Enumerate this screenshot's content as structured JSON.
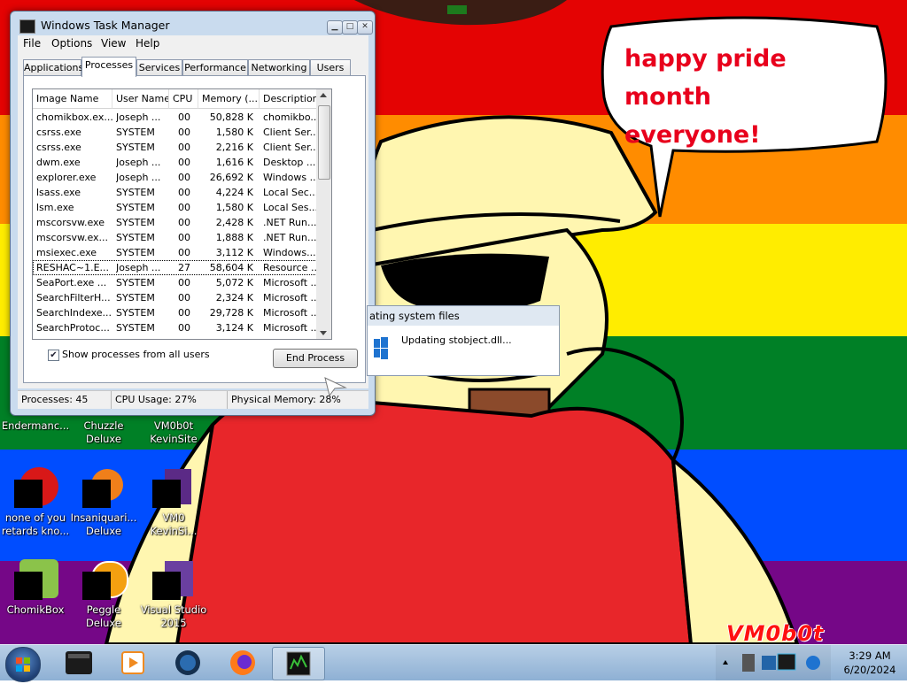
{
  "desktop": {
    "speech_bubble": {
      "line1": "happy pride month",
      "line2": "everyone!"
    },
    "watermark": "VM0b0t",
    "icons": [
      {
        "label": "Endermanc...",
        "icon": "app-icon"
      },
      {
        "label": "Chuzzle Deluxe",
        "icon": "game-icon"
      },
      {
        "label": "VM0b0t KevinSite",
        "icon": "shortcut-icon"
      },
      {
        "label": "none of you retards kno...",
        "icon": "opera-icon"
      },
      {
        "label": "Insaniquari... Deluxe",
        "icon": "game-icon"
      },
      {
        "label": "VM0 KevinSi...",
        "icon": "shortcut-icon"
      },
      {
        "label": "ChomikBox",
        "icon": "chomikbox-icon"
      },
      {
        "label": "Peggle Deluxe",
        "icon": "peggle-icon"
      },
      {
        "label": "Visual Studio 2015",
        "icon": "visual-studio-icon"
      }
    ]
  },
  "task_manager": {
    "title": "Windows Task Manager",
    "menu": [
      "File",
      "Options",
      "View",
      "Help"
    ],
    "tabs": [
      "Applications",
      "Processes",
      "Services",
      "Performance",
      "Networking",
      "Users"
    ],
    "active_tab": "Processes",
    "columns": [
      "Image Name",
      "User Name",
      "CPU",
      "Memory (...",
      "Description"
    ],
    "rows": [
      [
        "chomikbox.ex...",
        "Joseph ...",
        "00",
        "50,828 K",
        "chomikbo..."
      ],
      [
        "csrss.exe",
        "SYSTEM",
        "00",
        "1,580 K",
        "Client Ser..."
      ],
      [
        "csrss.exe",
        "SYSTEM",
        "00",
        "2,216 K",
        "Client Ser..."
      ],
      [
        "dwm.exe",
        "Joseph ...",
        "00",
        "1,616 K",
        "Desktop ..."
      ],
      [
        "explorer.exe",
        "Joseph ...",
        "00",
        "26,692 K",
        "Windows ..."
      ],
      [
        "lsass.exe",
        "SYSTEM",
        "00",
        "4,224 K",
        "Local Sec..."
      ],
      [
        "lsm.exe",
        "SYSTEM",
        "00",
        "1,580 K",
        "Local Ses..."
      ],
      [
        "mscorsvw.exe",
        "SYSTEM",
        "00",
        "2,428 K",
        ".NET Run..."
      ],
      [
        "mscorsvw.ex...",
        "SYSTEM",
        "00",
        "1,888 K",
        ".NET Run..."
      ],
      [
        "msiexec.exe",
        "SYSTEM",
        "00",
        "3,112 K",
        "Windows..."
      ],
      [
        "RESHAC~1.E...",
        "Joseph ...",
        "27",
        "58,604 K",
        "Resource ..."
      ],
      [
        "SeaPort.exe ...",
        "SYSTEM",
        "00",
        "5,072 K",
        "Microsoft ..."
      ],
      [
        "SearchFilterH...",
        "SYSTEM",
        "00",
        "2,324 K",
        "Microsoft ..."
      ],
      [
        "SearchIndexe...",
        "SYSTEM",
        "00",
        "29,728 K",
        "Microsoft ..."
      ],
      [
        "SearchProtoc...",
        "SYSTEM",
        "00",
        "3,124 K",
        "Microsoft ..."
      ]
    ],
    "selected_row": 10,
    "show_all_label": "Show processes from all users",
    "show_all_checked": true,
    "end_process_label": "End Process",
    "status": {
      "processes": "Processes: 45",
      "cpu": "CPU Usage: 27%",
      "memory": "Physical Memory: 28%"
    }
  },
  "update_dialog": {
    "title": "ating system files",
    "message": "Updating stobject.dll..."
  },
  "taskbar": {
    "pinned": [
      "terminal-icon",
      "media-player-icon",
      "app-globe-icon",
      "firefox-icon",
      "task-manager-icon"
    ],
    "clock_time": "3:29 AM",
    "clock_date": "6/20/2024"
  },
  "colors": {
    "rainbow": [
      "#e40303",
      "#ff8c00",
      "#ffed00",
      "#008026",
      "#004dff",
      "#750787"
    ],
    "bubble_text": "#e8001c",
    "watermark": "#ff1010"
  }
}
